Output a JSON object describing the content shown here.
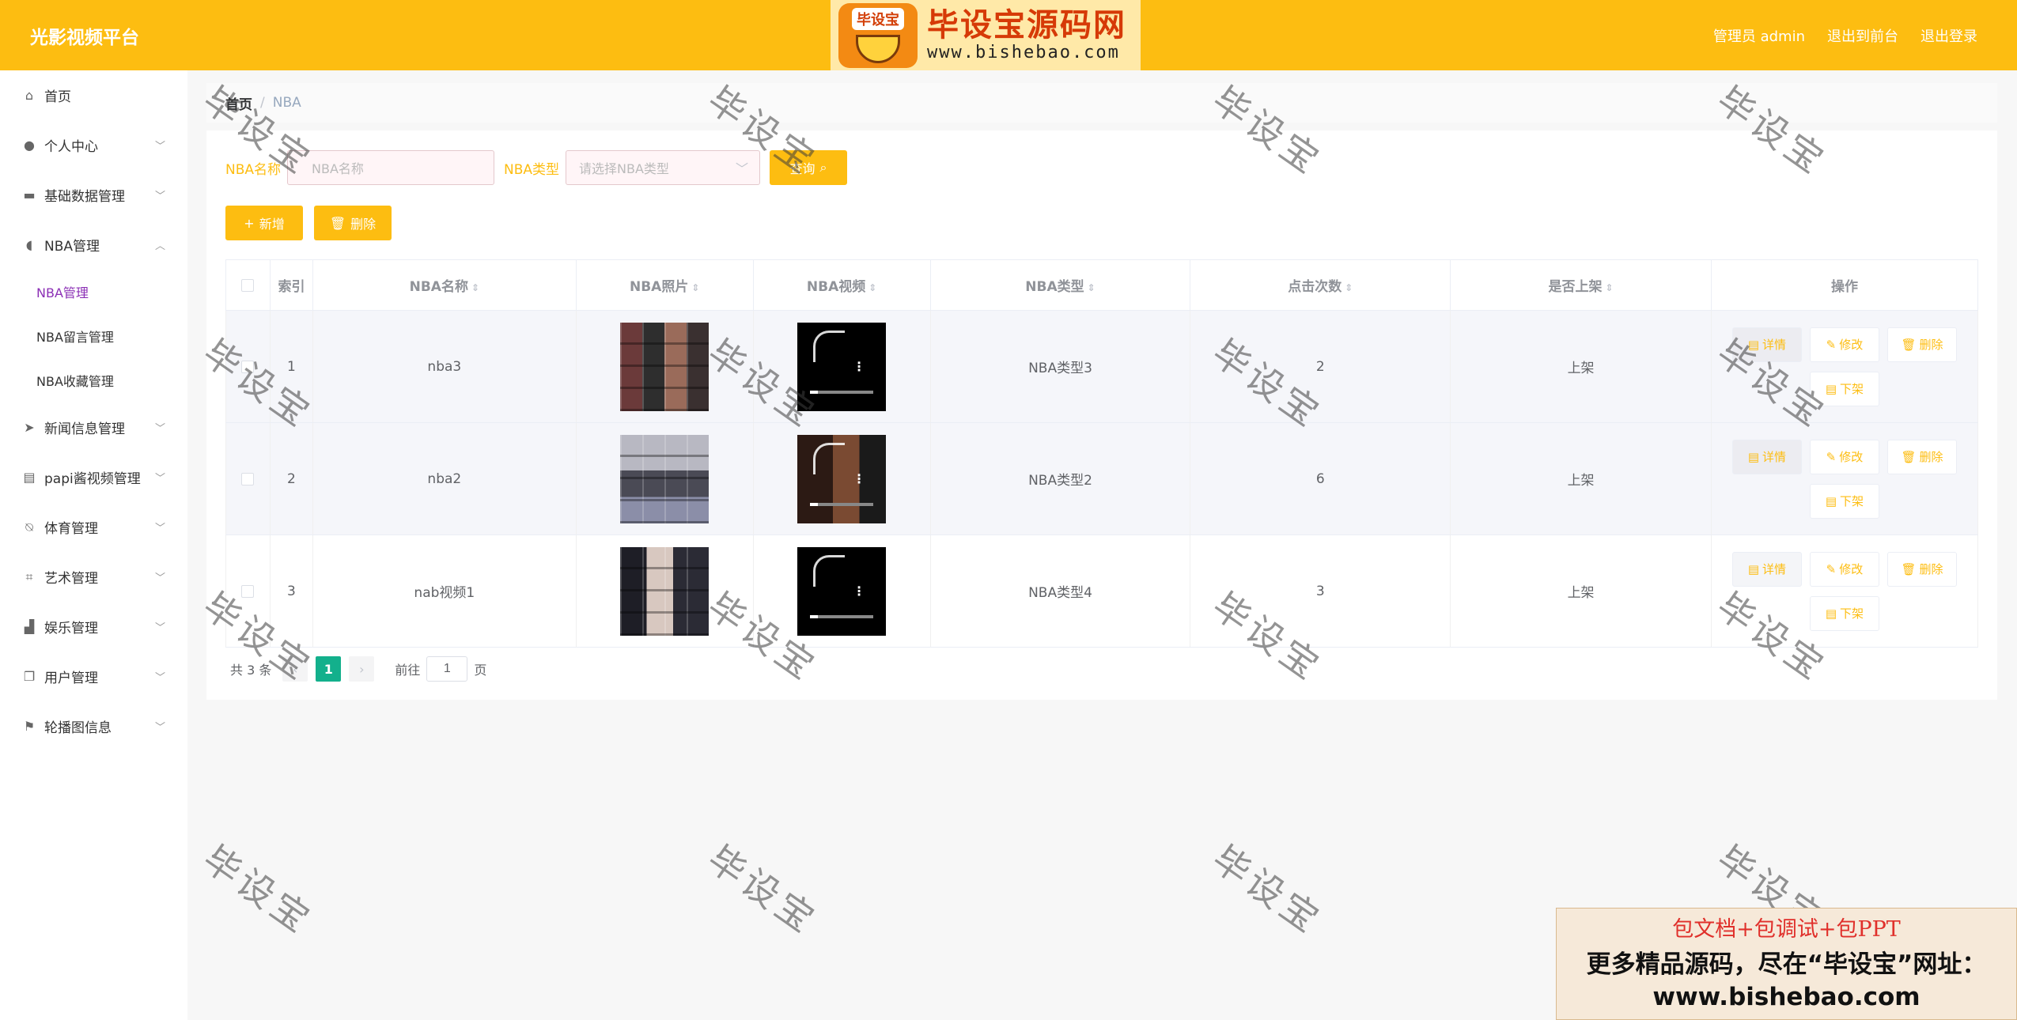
{
  "header": {
    "app_title": "光影视频平台",
    "user_label": "管理员 admin",
    "back_to_front": "退出到前台",
    "logout": "退出登录"
  },
  "brand": {
    "badge": "毕设宝",
    "name": "毕设宝源码网",
    "url": "www.bishebao.com"
  },
  "sidebar": {
    "items": [
      {
        "label": "首页",
        "icon": "home-icon"
      },
      {
        "label": "个人中心",
        "icon": "user-icon"
      },
      {
        "label": "基础数据管理",
        "icon": "briefcase-icon"
      },
      {
        "label": "NBA管理",
        "icon": "balloon-icon"
      },
      {
        "label": "新闻信息管理",
        "icon": "send-icon"
      },
      {
        "label": "papi酱视频管理",
        "icon": "clipboard-icon"
      },
      {
        "label": "体育管理",
        "icon": "bell-off-icon"
      },
      {
        "label": "艺术管理",
        "icon": "crop-icon"
      },
      {
        "label": "娱乐管理",
        "icon": "thumb-up-icon"
      },
      {
        "label": "用户管理",
        "icon": "copy-icon"
      },
      {
        "label": "轮播图信息",
        "icon": "flag-icon"
      }
    ],
    "nba_submenu": [
      {
        "label": "NBA管理",
        "active": true
      },
      {
        "label": "NBA留言管理",
        "active": false
      },
      {
        "label": "NBA收藏管理",
        "active": false
      }
    ]
  },
  "breadcrumb": {
    "home": "首页",
    "separator": "/",
    "current": "NBA"
  },
  "search": {
    "name_label": "NBA名称",
    "name_placeholder": "NBA名称",
    "type_label": "NBA类型",
    "type_placeholder": "请选择NBA类型",
    "query_button": "查询"
  },
  "actions": {
    "add": "新增",
    "delete": "删除"
  },
  "table": {
    "headers": {
      "index": "索引",
      "name": "NBA名称",
      "photo": "NBA照片",
      "video": "NBA视频",
      "type": "NBA类型",
      "clicks": "点击次数",
      "on_shelf": "是否上架",
      "ops": "操作"
    },
    "rows": [
      {
        "index": "1",
        "name": "nba3",
        "type": "NBA类型3",
        "clicks": "2",
        "on_shelf": "上架"
      },
      {
        "index": "2",
        "name": "nba2",
        "type": "NBA类型2",
        "clicks": "6",
        "on_shelf": "上架"
      },
      {
        "index": "3",
        "name": "nab视频1",
        "type": "NBA类型4",
        "clicks": "3",
        "on_shelf": "上架"
      }
    ],
    "op_labels": {
      "detail": "详情",
      "edit": "修改",
      "delete": "删除",
      "offline": "下架"
    }
  },
  "pager": {
    "total": "共 3 条",
    "current_page": "1",
    "goto_label": "前往",
    "goto_value": "1",
    "page_suffix": "页"
  },
  "watermark": "毕设宝",
  "ad": {
    "line1": "包文档+包调试+包PPT",
    "line2": "更多精品源码，尽在“毕设宝”网址：",
    "line3": "www.bishebao.com"
  },
  "colors": {
    "header_bg": "#fdbd11",
    "active_submenu": "#8b2fb5",
    "pager_active": "#13b08c"
  }
}
